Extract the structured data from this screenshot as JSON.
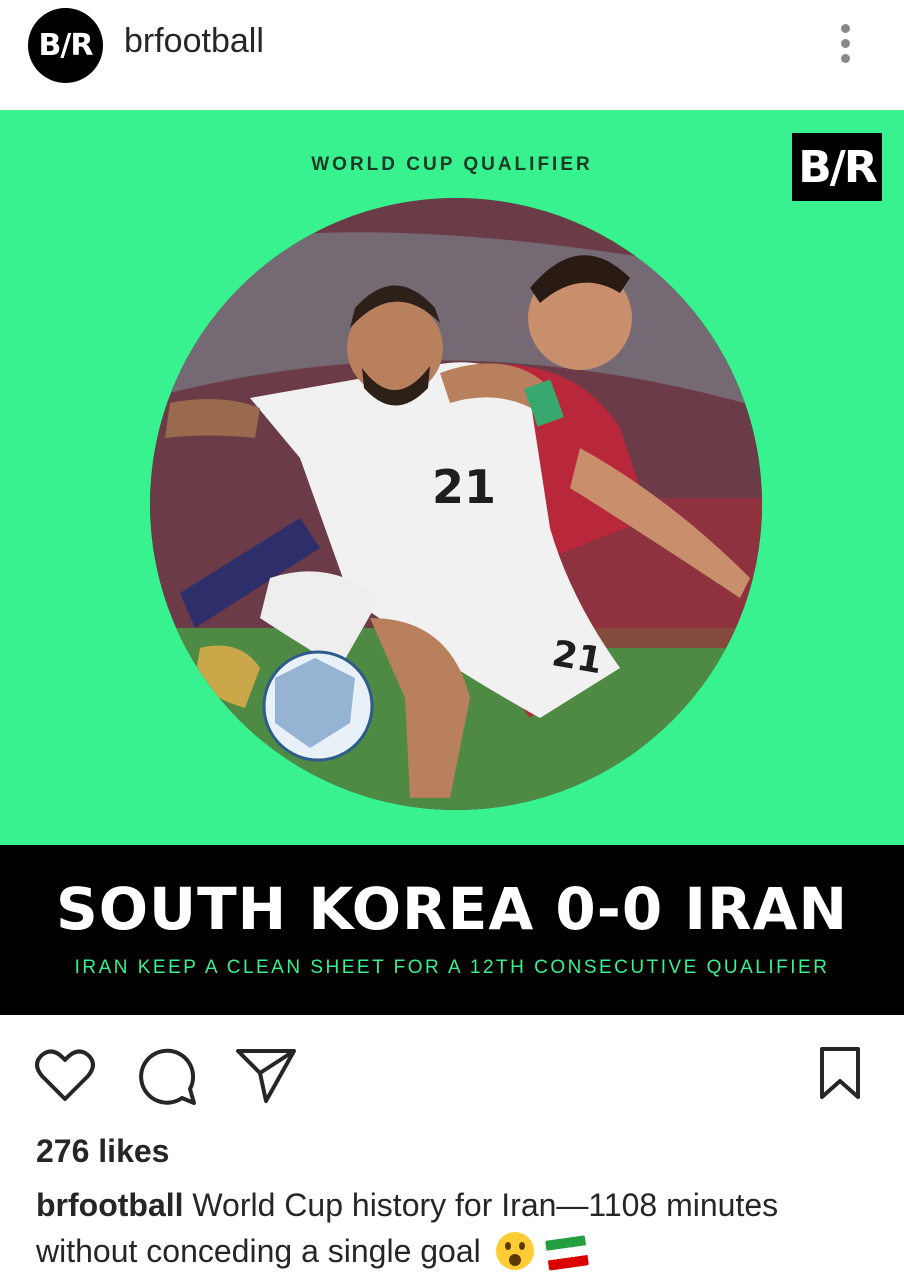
{
  "header": {
    "avatar_text": "B/R",
    "username": "brfootball"
  },
  "post": {
    "kicker": "WORLD CUP QUALIFIER",
    "logo_text": "B/R",
    "headline": "SOUTH KOREA 0-0 IRAN",
    "subline": "IRAN KEEP A CLEAN SHEET FOR A 12TH CONSECUTIVE QUALIFIER",
    "player_number": "21",
    "bg_color": "#37f28e"
  },
  "actions": {
    "icons": [
      "heart-icon",
      "comment-icon",
      "share-icon",
      "bookmark-icon"
    ]
  },
  "likes_text": "276 likes",
  "caption": {
    "username": "brfootball",
    "text": "World Cup history for Iran—1108 minutes without conceding a single goal",
    "emojis": [
      "face-screaming-emoji",
      "iran-flag-emoji"
    ]
  }
}
